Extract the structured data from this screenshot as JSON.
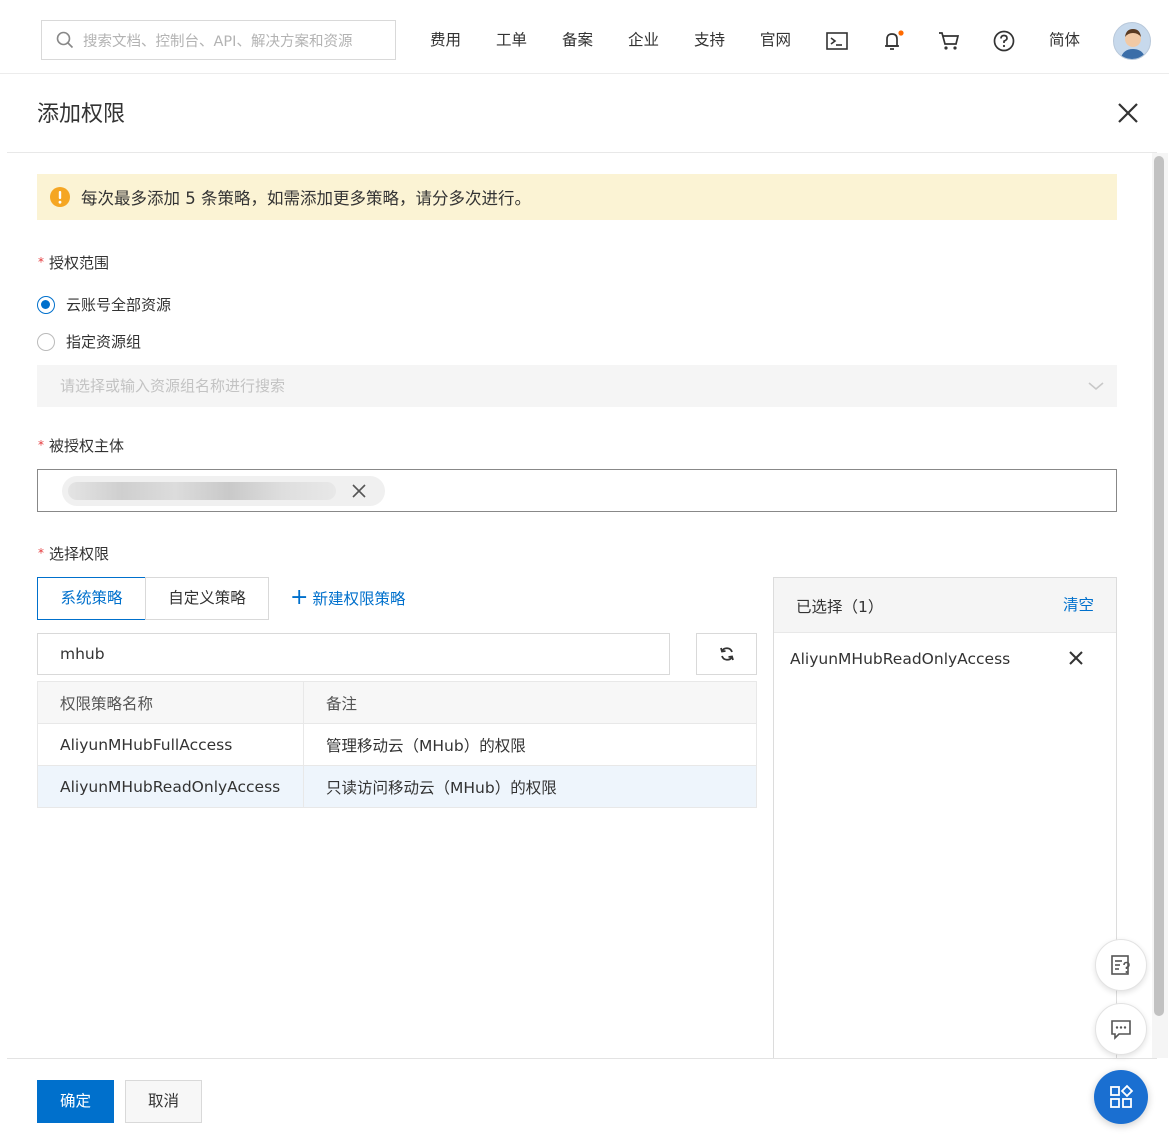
{
  "topbar": {
    "search_placeholder": "搜索文档、控制台、API、解决方案和资源",
    "nav": [
      "费用",
      "工单",
      "备案",
      "企业",
      "支持",
      "官网"
    ],
    "lang": "简体"
  },
  "panel": {
    "title": "添加权限",
    "alert": "每次最多添加 5 条策略，如需添加更多策略，请分多次进行。",
    "scope": {
      "label": "授权范围",
      "options": [
        "云账号全部资源",
        "指定资源组"
      ],
      "selected": "云账号全部资源",
      "resource_group_placeholder": "请选择或输入资源组名称进行搜索"
    },
    "principal": {
      "label": "被授权主体"
    },
    "permissions": {
      "label": "选择权限",
      "tabs": [
        "系统策略",
        "自定义策略"
      ],
      "active_tab": "系统策略",
      "new_policy": "新建权限策略",
      "filter_value": "mhub",
      "columns": [
        "权限策略名称",
        "备注"
      ],
      "rows": [
        {
          "name": "AliyunMHubFullAccess",
          "note": "管理移动云（MHub）的权限"
        },
        {
          "name": "AliyunMHubReadOnlyAccess",
          "note": "只读访问移动云（MHub）的权限"
        }
      ]
    },
    "selected_panel": {
      "title": "已选择（1）",
      "clear": "清空",
      "items": [
        "AliyunMHubReadOnlyAccess"
      ]
    },
    "footer": {
      "confirm": "确定",
      "cancel": "取消"
    }
  },
  "colors": {
    "accent": "#0070cc",
    "alert_bg": "#fbf3d4",
    "warning": "#f5a623",
    "notify_dot": "#ff6a00"
  },
  "icons": [
    "search-icon",
    "terminal-icon",
    "bell-icon",
    "cart-icon",
    "help-icon",
    "close-icon",
    "warning-icon",
    "chevron-down-icon",
    "refresh-icon",
    "feedback-icon",
    "chat-icon",
    "apps-icon"
  ]
}
